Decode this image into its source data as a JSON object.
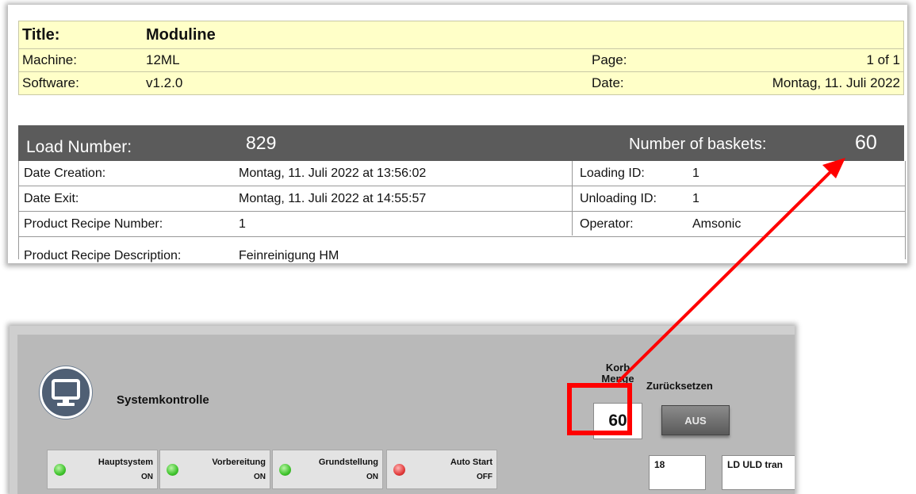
{
  "report": {
    "title_label": "Title:",
    "title_value": "Moduline",
    "machine_label": "Machine:",
    "machine_value": "12ML",
    "page_label": "Page:",
    "page_value": "1 of 1",
    "software_label": "Software:",
    "software_value": "v1.2.0",
    "date_label": "Date:",
    "date_value": "Montag, 11. Juli 2022",
    "load_number_label": "Load Number:",
    "load_number_value": "829",
    "baskets_label": "Number of baskets:",
    "baskets_value": "60",
    "rows": [
      {
        "label": "Date Creation:",
        "value": "Montag, 11. Juli 2022 at 13:56:02",
        "label2": "Loading ID:",
        "value2": "1"
      },
      {
        "label": "Date Exit:",
        "value": "Montag, 11. Juli 2022 at 14:55:57",
        "label2": "Unloading ID:",
        "value2": "1"
      },
      {
        "label": "Product Recipe Number:",
        "value": "1",
        "label2": "Operator:",
        "value2": "Amsonic"
      },
      {
        "label": "Product Recipe Description:",
        "value": "Feinreinigung HM"
      }
    ]
  },
  "hmi": {
    "title": "Systemkontrolle",
    "icon": "monitor-icon",
    "korb_label_line1": "Korb",
    "korb_label_line2": "Menge",
    "korb_value": "60",
    "reset_label": "Zurücksetzen",
    "reset_button_label": "AUS",
    "status": [
      {
        "label": "Hauptsystem",
        "state": "ON",
        "color": "green"
      },
      {
        "label": "Vorbereitung",
        "state": "ON",
        "color": "green"
      },
      {
        "label": "Grundstellung",
        "state": "ON",
        "color": "green"
      },
      {
        "label": "Auto Start",
        "state": "OFF",
        "color": "red"
      }
    ],
    "field_value": "18",
    "field_text": "LD ULD tran"
  },
  "colors": {
    "header_bg": "#ffffc8",
    "dark_bar": "#5b5b5b",
    "hmi_bg": "#b9b9b9",
    "highlight": "#ff0000",
    "led_on": "#3fc42c",
    "led_off": "#e23b3b"
  }
}
